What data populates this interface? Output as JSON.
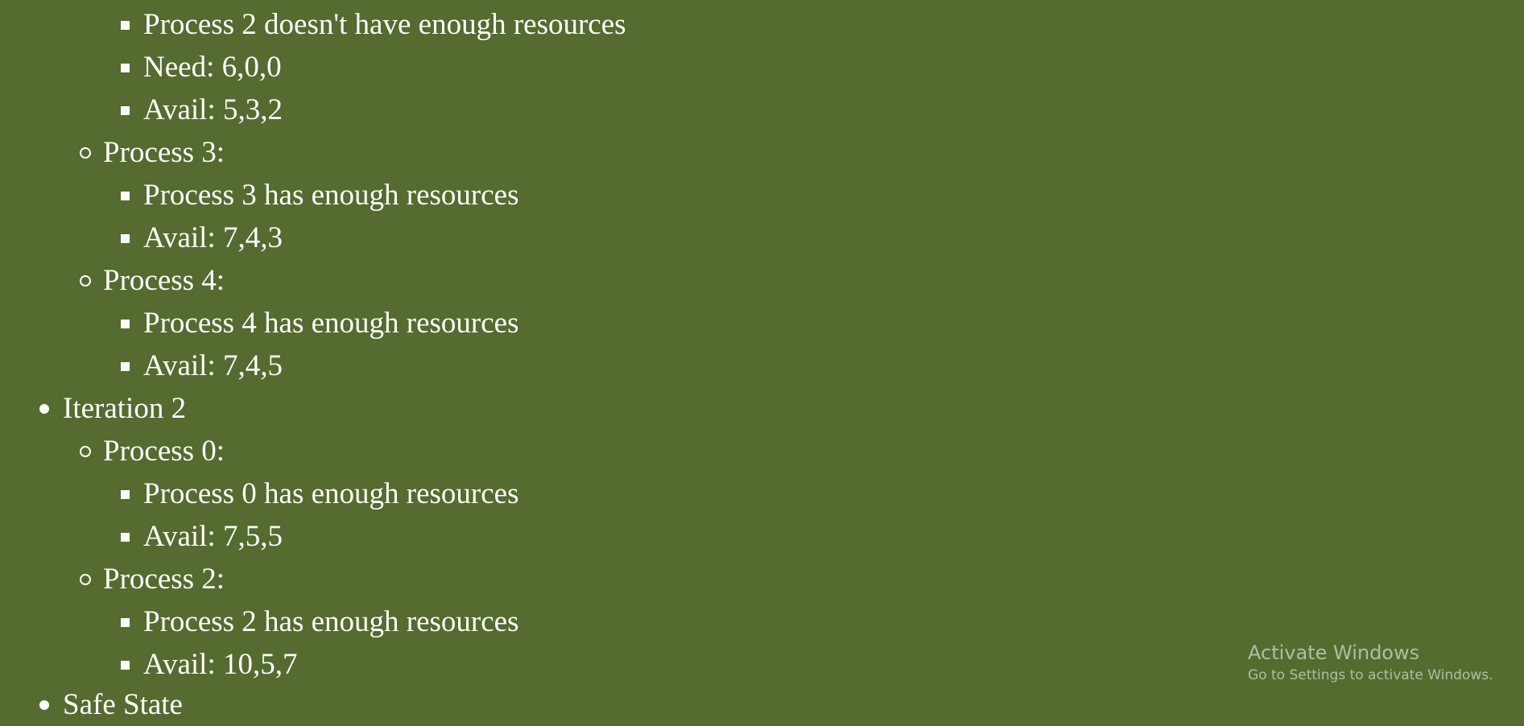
{
  "lines": [
    {
      "text": "Process 2 doesn't have enough resources"
    },
    {
      "text": "Need: 6,0,0"
    },
    {
      "text": "Avail: 5,3,2"
    },
    {
      "text": "Process 3:"
    },
    {
      "text": "Process 3 has enough resources"
    },
    {
      "text": "Avail: 7,4,3"
    },
    {
      "text": "Process 4:"
    },
    {
      "text": "Process 4 has enough resources"
    },
    {
      "text": "Avail: 7,4,5"
    },
    {
      "text": "Iteration 2"
    },
    {
      "text": "Process 0:"
    },
    {
      "text": "Process 0 has enough resources"
    },
    {
      "text": "Avail: 7,5,5"
    },
    {
      "text": "Process 2:"
    },
    {
      "text": "Process 2 has enough resources"
    },
    {
      "text": "Avail: 10,5,7"
    },
    {
      "text": "Safe State"
    }
  ],
  "watermark": {
    "title": "Activate Windows",
    "subtitle": "Go to Settings to activate Windows."
  },
  "colors": {
    "background": "#556b2f",
    "text": "#ffffff"
  }
}
